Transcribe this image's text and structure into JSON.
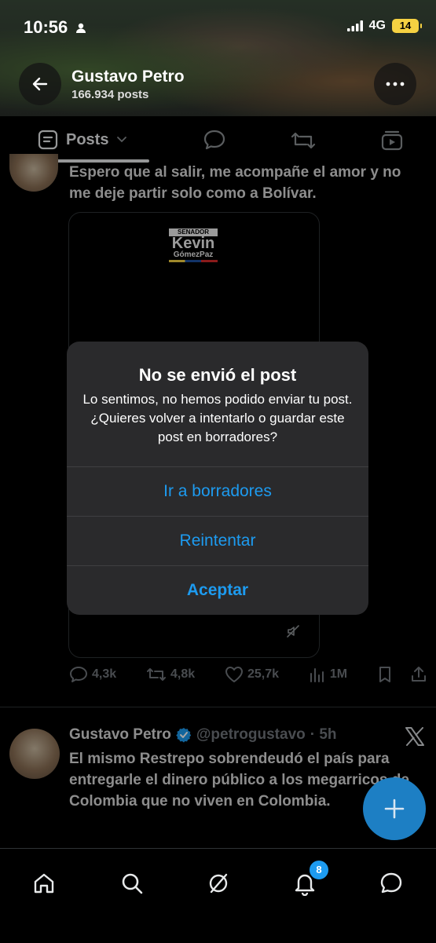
{
  "status_bar": {
    "time": "10:56",
    "network": "4G",
    "battery": "14"
  },
  "profile": {
    "name": "Gustavo Petro",
    "posts_count": "166.934 posts"
  },
  "tabs": {
    "posts_label": "Posts"
  },
  "tweet1": {
    "text": "Espero que al salir, me acompañe el amor y no me deje partir solo como a Bolívar.",
    "media_logo": {
      "line1": "SENADOR",
      "line2": "Kevin",
      "line3": "GómezPaz"
    },
    "stats": {
      "replies": "4,3k",
      "reposts": "4,8k",
      "likes": "25,7k",
      "views": "1M"
    }
  },
  "alert": {
    "title": "No se envió el post",
    "message": "Lo sentimos, no hemos podido enviar tu post. ¿Quieres volver a intentarlo o guardar este post en borradores?",
    "btn_drafts": "Ir a borradores",
    "btn_retry": "Reintentar",
    "btn_accept": "Aceptar"
  },
  "tweet2": {
    "author": "Gustavo Petro",
    "handle": "@petrogustavo",
    "time": "· 5h",
    "text": "El mismo Restrepo sobrendeudó el país para entregarle el dinero público a los megarricos de Colombia que no viven en Colombia."
  },
  "bottom_nav": {
    "notifications_badge": "8"
  },
  "colors": {
    "accent": "#1d9bf0",
    "background": "#000000",
    "alert_bg": "#2a2a2c",
    "muted": "#71767b",
    "verified": "#1d9bf0"
  },
  "icons": [
    "back-arrow-icon",
    "more-icon",
    "posts-tab-icon",
    "chevron-down-icon",
    "replies-tab-icon",
    "reposts-tab-icon",
    "media-tab-icon",
    "reply-icon",
    "repost-icon",
    "like-icon",
    "views-icon",
    "bookmark-icon",
    "share-icon",
    "mute-icon",
    "verified-icon",
    "x-logo-icon",
    "compose-plus-icon",
    "home-icon",
    "search-icon",
    "grok-icon",
    "notifications-icon",
    "messages-icon"
  ]
}
